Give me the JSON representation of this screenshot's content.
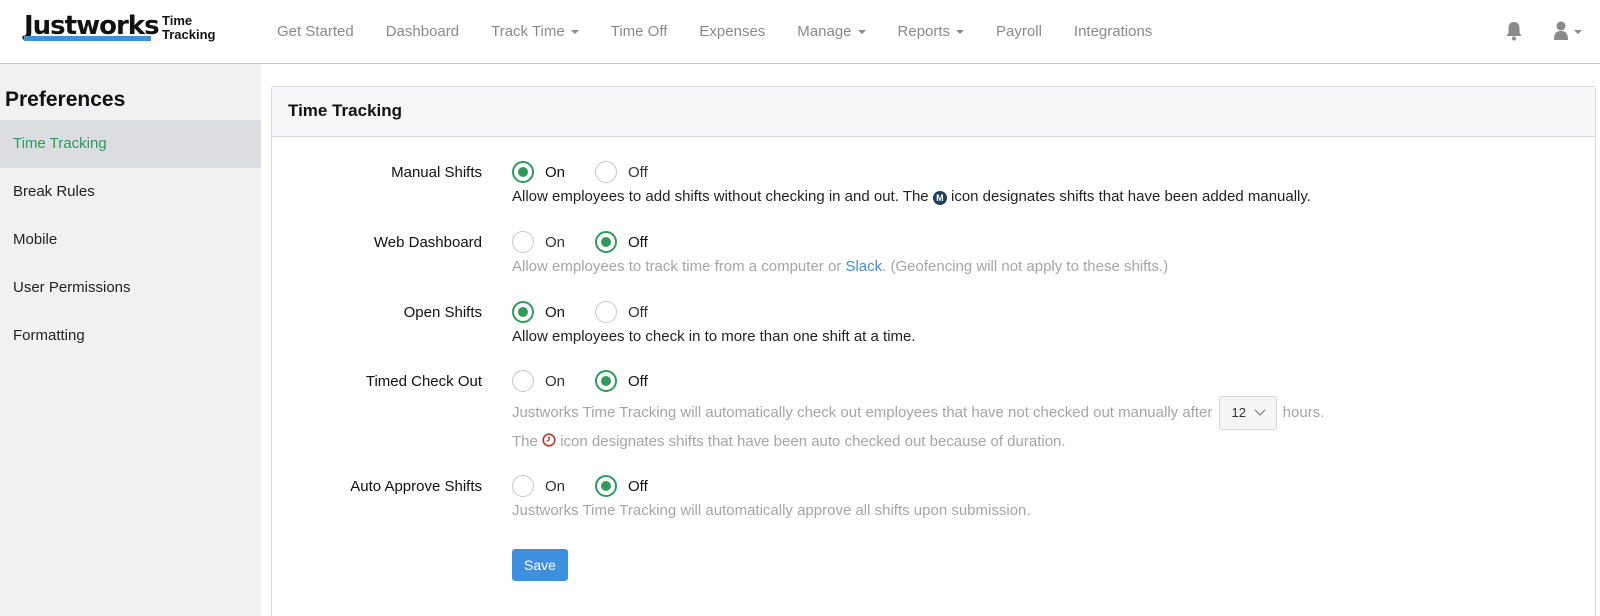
{
  "brand": {
    "name": "Justworks",
    "sub_line1": "Time",
    "sub_line2": "Tracking"
  },
  "nav": {
    "items": [
      {
        "label": "Get Started"
      },
      {
        "label": "Dashboard"
      },
      {
        "label": "Track Time"
      },
      {
        "label": "Time Off"
      },
      {
        "label": "Expenses"
      },
      {
        "label": "Manage"
      },
      {
        "label": "Reports"
      },
      {
        "label": "Payroll"
      },
      {
        "label": "Integrations"
      }
    ],
    "icons": [
      "bell-icon",
      "user-icon"
    ]
  },
  "sidebar": {
    "title": "Preferences",
    "items": [
      {
        "label": "Time Tracking",
        "active": true
      },
      {
        "label": "Break Rules"
      },
      {
        "label": "Mobile"
      },
      {
        "label": "User Permissions"
      },
      {
        "label": "Formatting"
      }
    ]
  },
  "panel": {
    "title": "Time Tracking",
    "on_label": "On",
    "off_label": "Off",
    "settings": [
      {
        "label": "Manual Shifts",
        "value": "On",
        "desc_before": "Allow employees to add shifts without checking in and out. The",
        "desc_after": "icon designates shifts that have been added manually.",
        "icon_text": "M"
      },
      {
        "label": "Web Dashboard",
        "value": "Off",
        "desc_before": "Allow employees to track time from a computer or",
        "link": "Slack",
        "desc_after": ". (Geofencing will not apply to these shifts.)"
      },
      {
        "label": "Open Shifts",
        "value": "On",
        "desc": "Allow employees to check in to more than one shift at a time."
      },
      {
        "label": "Timed Check Out",
        "value": "Off",
        "desc_before": "Justworks Time Tracking will automatically check out employees that have not checked out manually after",
        "hours_value": "12",
        "desc_after": "hours.",
        "desc2_before": "The",
        "desc2_after": "icon designates shifts that have been auto checked out because of duration."
      },
      {
        "label": "Auto Approve Shifts",
        "value": "Off",
        "desc": "Justworks Time Tracking will automatically approve all shifts upon submission."
      }
    ],
    "save_label": "Save"
  },
  "colors": {
    "accent_green": "#2f9a5c",
    "link_blue": "#3f8fe0",
    "clock_red": "#c0392b"
  }
}
